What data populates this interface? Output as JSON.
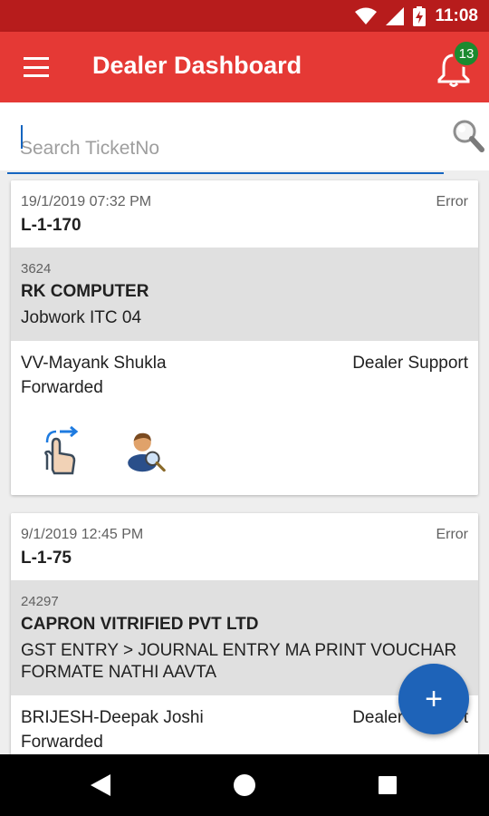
{
  "status_bar": {
    "time": "11:08",
    "icons": [
      "wifi-icon",
      "signal-icon",
      "battery-charging-icon"
    ]
  },
  "app_bar": {
    "title": "Dealer Dashboard",
    "notification_count": "13",
    "icons": [
      "menu-icon",
      "bell-icon"
    ]
  },
  "search": {
    "placeholder": "Search TicketNo",
    "value": ""
  },
  "tickets": [
    {
      "date": "19/1/2019 07:32 PM",
      "status": "Error",
      "ticket_no": "L-1-170",
      "code": "3624",
      "company": "RK COMPUTER",
      "description": "Jobwork ITC 04",
      "person": "VV-Mayank Shukla",
      "department": "Dealer Support",
      "state": "Forwarded",
      "actions": [
        "tap-forward-icon",
        "user-search-icon"
      ]
    },
    {
      "date": "9/1/2019 12:45 PM",
      "status": "Error",
      "ticket_no": "L-1-75",
      "code": "24297",
      "company": "CAPRON VITRIFIED PVT LTD",
      "description": "GST ENTRY > JOURNAL ENTRY MA PRINT VOUCHAR FORMATE NATHI AAVTA",
      "person": "BRIJESH-Deepak Joshi",
      "department": "Dealer Support",
      "state": "Forwarded"
    }
  ],
  "fab": {
    "label": "+"
  },
  "colors": {
    "primary": "#e53935",
    "status_bar": "#b71c1c",
    "accent": "#1e63b8",
    "badge": "#1b8a2f"
  }
}
